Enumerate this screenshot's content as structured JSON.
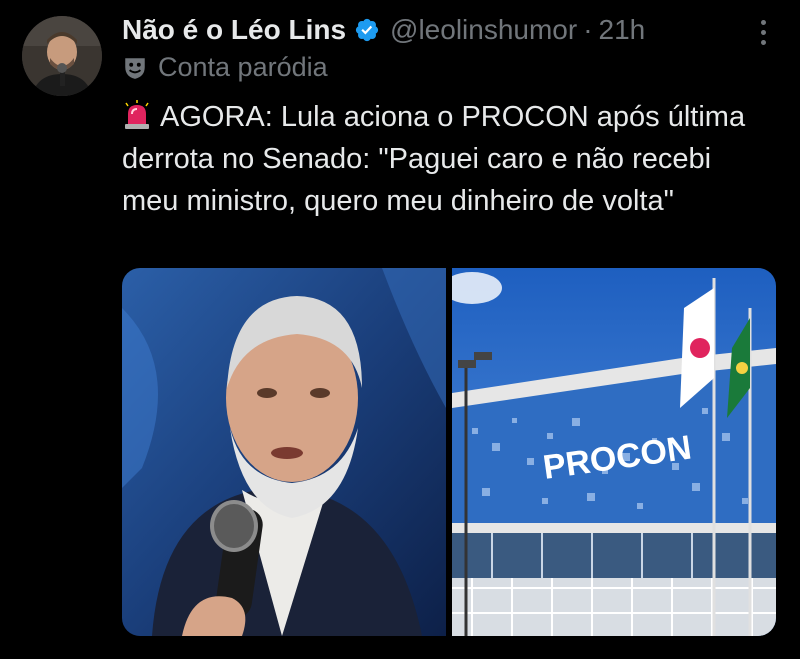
{
  "tweet": {
    "display_name": "Não é o Léo Lins",
    "verified_icon": "verified-badge-icon",
    "handle": "@leolinshumor",
    "separator": "·",
    "time": "21h",
    "label_icon": "theater-mask-icon",
    "label": "Conta paródia",
    "text_prefix_icon": "siren-icon",
    "text": "AGORA: Lula aciona o PROCON após última derrota no Senado: \"Paguei caro e não recebi meu ministro, quero meu dinheiro de volta\"",
    "images": [
      {
        "description_icon": "photo-man-microphone"
      },
      {
        "sign_text": "PROCON"
      }
    ]
  },
  "colors": {
    "background": "#000000",
    "text_primary": "#e7e9ea",
    "text_secondary": "#71767b",
    "verified": "#1d9bf0"
  }
}
